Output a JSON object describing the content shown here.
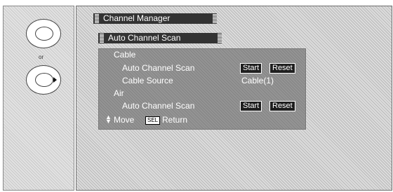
{
  "left_panel": {
    "or_label": "or",
    "remote_icons": [
      "menu-button-icon",
      "dpad-right-icon"
    ]
  },
  "osd": {
    "tab_main": "Channel Manager",
    "tab_sub": "Auto Channel Scan",
    "sections": [
      {
        "title": "Cable",
        "rows": [
          {
            "label": "Auto Channel Scan",
            "buttons": [
              "Start",
              "Reset"
            ]
          },
          {
            "label": "Cable Source",
            "value": "Cable(1)"
          }
        ]
      },
      {
        "title": "Air",
        "rows": [
          {
            "label": "Auto Channel Scan",
            "buttons": [
              "Start",
              "Reset"
            ]
          }
        ]
      }
    ],
    "footer": {
      "move_label": "Move",
      "sel_key": "SEL",
      "return_label": "Return"
    }
  }
}
